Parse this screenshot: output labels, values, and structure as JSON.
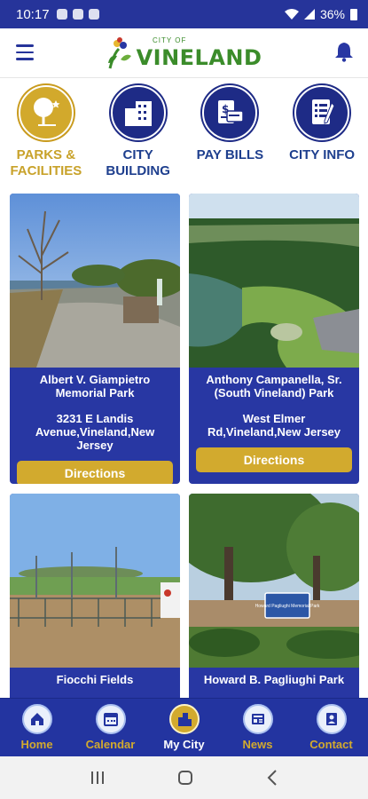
{
  "status": {
    "time": "10:17",
    "battery": "36%"
  },
  "header": {
    "logo_small": "CITY OF",
    "logo_big": "VINELAND"
  },
  "categories": [
    {
      "label_1": "PARKS &",
      "label_2": "FACILITIES"
    },
    {
      "label_1": "CITY",
      "label_2": "BUILDING"
    },
    {
      "label_1": "PAY BILLS",
      "label_2": ""
    },
    {
      "label_1": "CITY INFO",
      "label_2": ""
    }
  ],
  "cards": [
    {
      "name": "Albert V. Giampietro Memorial Park",
      "address": "3231 E Landis Avenue,Vineland,New Jersey",
      "button": "Directions"
    },
    {
      "name": "Anthony Campanella, Sr. (South Vineland) Park",
      "address": "West Elmer Rd,Vineland,New Jersey",
      "button": "Directions"
    },
    {
      "name": "Fiocchi Fields",
      "address": "",
      "button": ""
    },
    {
      "name": "Howard B. Pagliughi Park",
      "address": "",
      "button": ""
    }
  ],
  "photo_sign_text": "Howard Pagliughi Memorial Park",
  "tabs": [
    {
      "label": "Home",
      "icon": "home-icon"
    },
    {
      "label": "Calendar",
      "icon": "calendar-icon"
    },
    {
      "label": "My City",
      "icon": "city-icon"
    },
    {
      "label": "News",
      "icon": "news-icon"
    },
    {
      "label": "Contact",
      "icon": "contact-icon"
    }
  ],
  "colors": {
    "primary": "#2837a3",
    "accent": "#d2aa2e",
    "logo_green": "#3b8c2a"
  }
}
